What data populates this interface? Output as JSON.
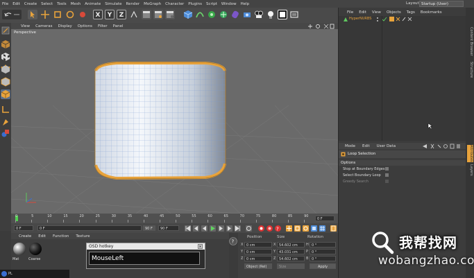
{
  "menubar": {
    "items": [
      "File",
      "Edit",
      "Create",
      "Select",
      "Tools",
      "Mesh",
      "Animate",
      "Simulate",
      "Render",
      "MoGraph",
      "Character",
      "Plugins",
      "Script",
      "Window",
      "Help"
    ],
    "layout_label": "Layout:",
    "layout_value": "Startup (User)"
  },
  "toolbar": {
    "axis_x": "X",
    "axis_y": "Y",
    "axis_z": "Z"
  },
  "viewport": {
    "menu": [
      "View",
      "Cameras",
      "Display",
      "Options",
      "Filter",
      "Panel"
    ],
    "label": "Perspective"
  },
  "timeline": {
    "ticks": [
      "0",
      "5",
      "10",
      "15",
      "20",
      "25",
      "30",
      "35",
      "40",
      "45",
      "50",
      "55",
      "60",
      "65",
      "70",
      "75",
      "80",
      "85",
      "90"
    ],
    "end_frame": "0 F"
  },
  "transport": {
    "start_field": "0 F",
    "current_field": "0 F",
    "preview_end": "90 F",
    "end_field": "90 F"
  },
  "material_panel": {
    "menu": [
      "Create",
      "Edit",
      "Function",
      "Texture"
    ],
    "materials": [
      {
        "name": "Mat"
      },
      {
        "name": "Coarse"
      }
    ]
  },
  "coord_panel": {
    "headers": [
      "Position",
      "Size",
      "Rotation"
    ],
    "rows": [
      {
        "axis": "X",
        "pos": "0 cm",
        "size": "54.602 cm",
        "rot_label": "H",
        "rot": "0 °"
      },
      {
        "axis": "Y",
        "pos": "0 cm",
        "size": "43.031 cm",
        "rot_label": "P",
        "rot": "0 °"
      },
      {
        "axis": "Z",
        "pos": "0 cm",
        "size": "54.602 cm",
        "rot_label": "B",
        "rot": "0 °"
      }
    ],
    "mode_select": "Object (Rel)",
    "size_select": "Size",
    "apply": "Apply"
  },
  "object_manager": {
    "menu": [
      "File",
      "Edit",
      "View",
      "Objects",
      "Tags",
      "Bookmarks"
    ],
    "objects": [
      {
        "name": "HyperNURBS"
      }
    ]
  },
  "attributes": {
    "menu": [
      "Mode",
      "Edit",
      "User Data"
    ],
    "title": "Loop Selection",
    "section": "Options",
    "options": [
      "Stop at Boundary Edges",
      "Select Boundary Loop",
      "Greedy Search"
    ]
  },
  "side_tabs": [
    "Content Browser",
    "Structure",
    "Attributes",
    "Layers"
  ],
  "osd": {
    "title": "OSD hotkey",
    "value": "MouseLeft"
  },
  "watermark": {
    "main": "我帮找网",
    "url": "wobangzhao.com"
  },
  "taskbar": {
    "label": "PL"
  },
  "colors": {
    "accent_orange": "#e8a33c",
    "accent_blue": "#4e8cd8",
    "viewport_bg": "#6a6a6a",
    "panel_bg": "#3c3c3c"
  }
}
